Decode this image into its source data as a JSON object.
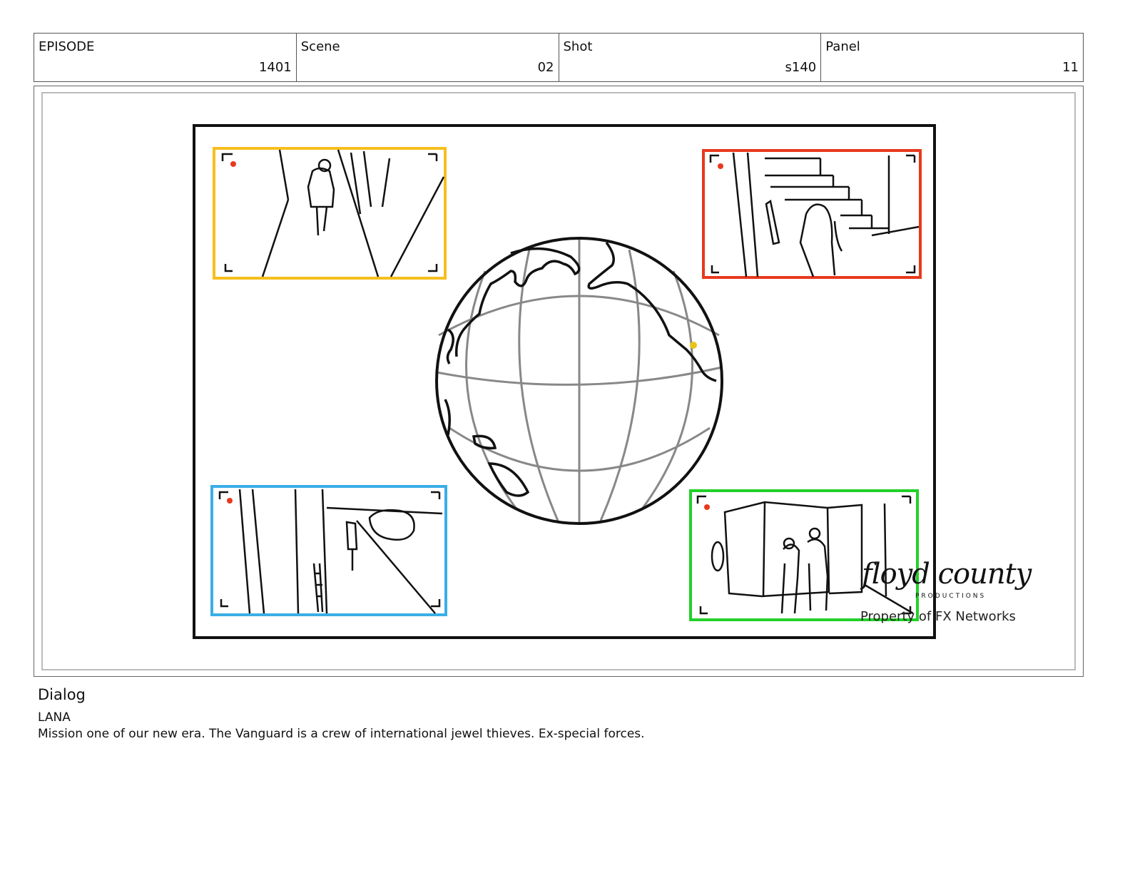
{
  "header": {
    "episode_label": "EPISODE",
    "episode_value": "1401",
    "scene_label": "Scene",
    "scene_value": "02",
    "shot_label": "Shot",
    "shot_value": "s140",
    "panel_label": "Panel",
    "panel_value": "11"
  },
  "watermark": {
    "logo_text": "floyd county",
    "logo_sub": "PRODUCTIONS",
    "property": "Property of FX Networks"
  },
  "dialog": {
    "heading": "Dialog",
    "speaker": "LANA",
    "line": "Mission one of our new era. The Vanguard is a crew of international jewel thieves. Ex-special forces."
  },
  "colors": {
    "frame_top_left": "#f7be1e",
    "frame_top_right": "#e8391c",
    "frame_bottom_left": "#3aaee6",
    "frame_bottom_right": "#22d02a",
    "rec_dot": "#e8391c",
    "location_dot": "#e8c417"
  }
}
